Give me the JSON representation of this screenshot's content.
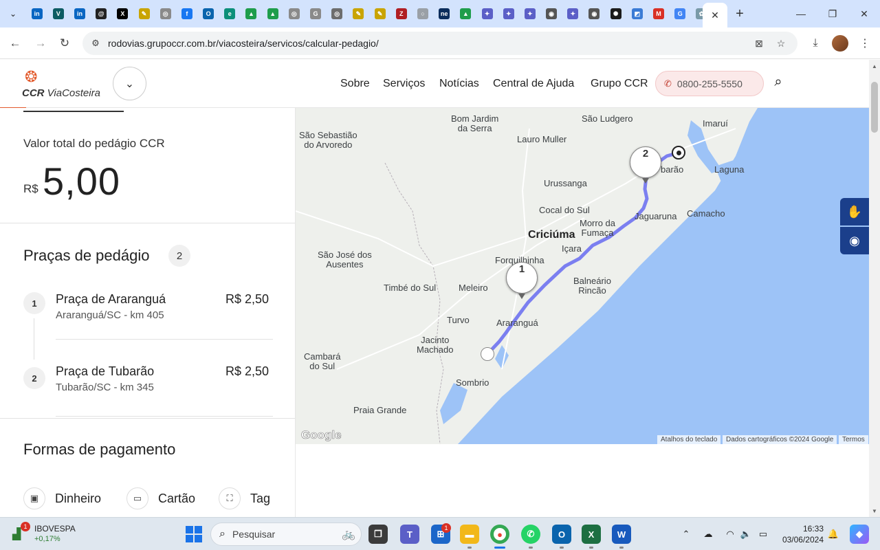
{
  "browser": {
    "url": "rodovias.grupoccr.com.br/viacosteira/servicos/calcular-pedagio/",
    "pinned_tabs": [
      {
        "icon": "linkedin-icon",
        "color": "#0a66c2",
        "glyph": "in"
      },
      {
        "icon": "valor-icon",
        "color": "#0d5c63",
        "glyph": "V"
      },
      {
        "icon": "linkedin-icon",
        "color": "#0a66c2",
        "glyph": "in"
      },
      {
        "icon": "threads-icon",
        "color": "#222222",
        "glyph": "@"
      },
      {
        "icon": "x-icon",
        "color": "#000000",
        "glyph": "X"
      },
      {
        "icon": "pencil-icon",
        "color": "#c9a400",
        "glyph": "✎"
      },
      {
        "icon": "globe-icon",
        "color": "#8a8a8a",
        "glyph": "◎"
      },
      {
        "icon": "facebook-icon",
        "color": "#1877f2",
        "glyph": "f"
      },
      {
        "icon": "outlook-icon",
        "color": "#0a64ad",
        "glyph": "O"
      },
      {
        "icon": "edge-icon",
        "color": "#0c8f7a",
        "glyph": "e"
      },
      {
        "icon": "drive-icon",
        "color": "#1e9d4b",
        "glyph": "▲"
      },
      {
        "icon": "drive-icon",
        "color": "#1e9d4b",
        "glyph": "▲"
      },
      {
        "icon": "globe-icon",
        "color": "#8a8a8a",
        "glyph": "◎"
      },
      {
        "icon": "google-icon",
        "color": "#8a8a8a",
        "glyph": "G"
      },
      {
        "icon": "globe-icon",
        "color": "#6d6d6d",
        "glyph": "◎"
      },
      {
        "icon": "pencil-icon",
        "color": "#c9a400",
        "glyph": "✎"
      },
      {
        "icon": "pencil-icon",
        "color": "#c9a400",
        "glyph": "✎"
      },
      {
        "icon": "zotero-icon",
        "color": "#b01e23",
        "glyph": "Z"
      },
      {
        "icon": "loading-icon",
        "color": "#9aa0a6",
        "glyph": "○"
      },
      {
        "icon": "ne-icon",
        "color": "#0b2d5c",
        "glyph": "ne"
      },
      {
        "icon": "drive-icon",
        "color": "#1e9d4b",
        "glyph": "▲"
      },
      {
        "icon": "apps-script-icon",
        "color": "#5b5fc7",
        "glyph": "✦"
      },
      {
        "icon": "apps-script-icon",
        "color": "#5b5fc7",
        "glyph": "✦"
      },
      {
        "icon": "apps-script-icon",
        "color": "#5b5fc7",
        "glyph": "✦"
      },
      {
        "icon": "globe-icon",
        "color": "#555555",
        "glyph": "◉"
      },
      {
        "icon": "apps-script-icon",
        "color": "#5b5fc7",
        "glyph": "✦"
      },
      {
        "icon": "globe-icon",
        "color": "#555555",
        "glyph": "◉"
      },
      {
        "icon": "openai-icon",
        "color": "#1b1b1b",
        "glyph": "✺"
      },
      {
        "icon": "box-icon",
        "color": "#3a7bd5",
        "glyph": "◩"
      },
      {
        "icon": "gmail-icon",
        "color": "#d93025",
        "glyph": "M"
      },
      {
        "icon": "google-icon",
        "color": "#4285f4",
        "glyph": "G"
      },
      {
        "icon": "settings-icon",
        "color": "#7a9aa8",
        "glyph": "✿"
      }
    ]
  },
  "header": {
    "logo_ccr": "CCR",
    "logo_name": "ViaCosteira",
    "menu": [
      "Sobre",
      "Serviços",
      "Notícias",
      "Central de Ajuda",
      "Grupo CCR"
    ],
    "phone": "0800-255-5550"
  },
  "summary": {
    "label": "Valor total do pedágio CCR",
    "currency": "R$",
    "value": "5,00"
  },
  "plazas": {
    "title": "Praças de pedágio",
    "count": "2",
    "items": [
      {
        "num": "1",
        "name": "Praça de Araranguá",
        "location": "Araranguá/SC - km 405",
        "price": "R$ 2,50"
      },
      {
        "num": "2",
        "name": "Praça de Tubarão",
        "location": "Tubarão/SC - km 345",
        "price": "R$ 2,50"
      }
    ]
  },
  "payment": {
    "title": "Formas de pagamento",
    "methods": [
      {
        "label": "Dinheiro",
        "icon": "cash-icon"
      },
      {
        "label": "Cartão",
        "icon": "card-icon"
      },
      {
        "label": "Tag",
        "icon": "tag-icon"
      }
    ]
  },
  "map": {
    "places": [
      {
        "name": "São Sebastião\ndo Arvoredo",
        "big": false
      },
      {
        "name": "Bom Jardim\nda Serra",
        "big": false
      },
      {
        "name": "São Ludgero",
        "big": false
      },
      {
        "name": "Imaruí",
        "big": false
      },
      {
        "name": "Lauro Muller",
        "big": false
      },
      {
        "name": "Laguna",
        "big": false
      },
      {
        "name": "barão",
        "big": false
      },
      {
        "name": "Urussanga",
        "big": false
      },
      {
        "name": "Cocal do Sul",
        "big": false
      },
      {
        "name": "Jaguaruna",
        "big": false
      },
      {
        "name": "Camacho",
        "big": false
      },
      {
        "name": "Morro da\nFumaça",
        "big": false
      },
      {
        "name": "Criciúma",
        "big": true
      },
      {
        "name": "Içara",
        "big": false
      },
      {
        "name": "São José dos\nAusentes",
        "big": false
      },
      {
        "name": "Forquilhinha",
        "big": false
      },
      {
        "name": "Timbé do Sul",
        "big": false
      },
      {
        "name": "Meleiro",
        "big": false
      },
      {
        "name": "Balneário\nRincão",
        "big": false
      },
      {
        "name": "Turvo",
        "big": false
      },
      {
        "name": "Araranguá",
        "big": false
      },
      {
        "name": "Jacinto\nMachado",
        "big": false
      },
      {
        "name": "Cambará\ndo Sul",
        "big": false
      },
      {
        "name": "Sombrio",
        "big": false
      },
      {
        "name": "Praia Grande",
        "big": false
      }
    ],
    "markers": [
      "1",
      "2"
    ],
    "google": "Google",
    "attribution": [
      "Atalhos do teclado",
      "Dados cartográficos ©2024 Google",
      "Termos"
    ],
    "route_color": "#7b7ff0",
    "sea_color": "#9dc3f7"
  },
  "taskbar": {
    "stock_name": "IBOVESPA",
    "stock_change": "+0,17%",
    "stock_badge": "1",
    "search_placeholder": "Pesquisar",
    "time": "16:33",
    "date": "03/06/2024",
    "store_badge": "1"
  }
}
